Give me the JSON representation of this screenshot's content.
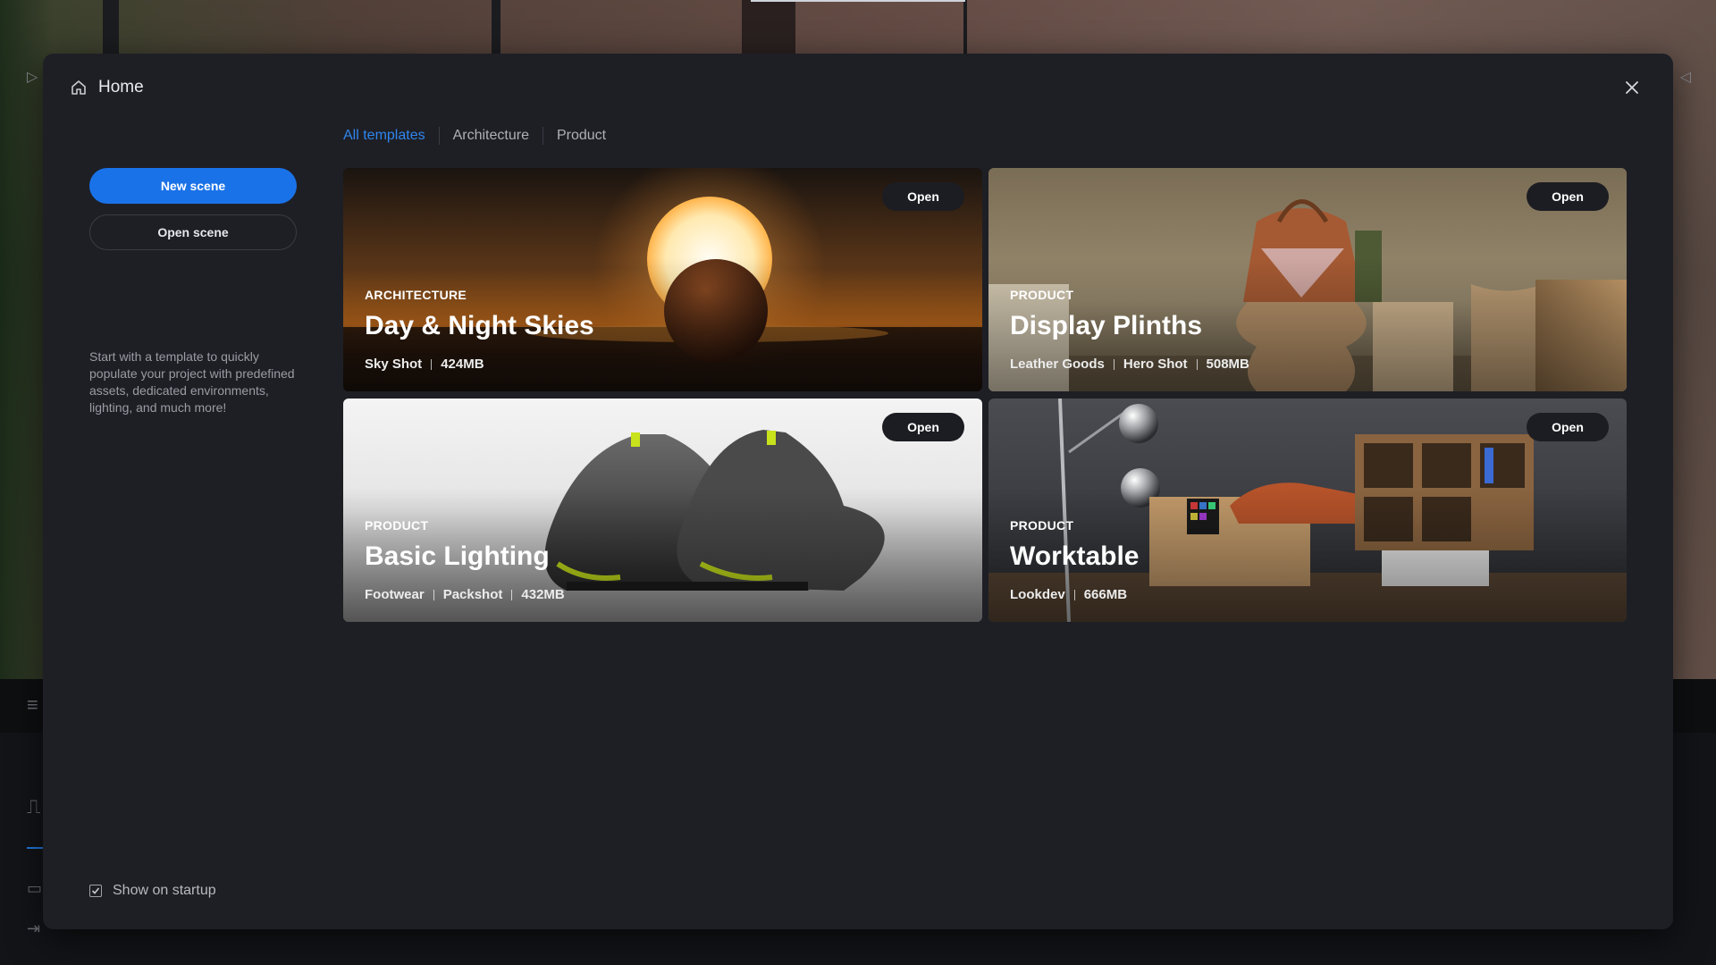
{
  "modal": {
    "title": "Home",
    "home_icon": "home-icon",
    "close_icon": "close-icon"
  },
  "sidebar": {
    "new_scene_label": "New scene",
    "open_scene_label": "Open scene",
    "intro_text": "Start with a template to quickly populate your project with predefined assets, dedicated environments, lighting, and much more!",
    "show_on_startup_label": "Show on startup",
    "show_on_startup_checked": true
  },
  "tabs": [
    {
      "label": "All templates",
      "active": true
    },
    {
      "label": "Architecture",
      "active": false
    },
    {
      "label": "Product",
      "active": false
    }
  ],
  "cards": [
    {
      "category": "ARCHITECTURE",
      "title": "Day & Night Skies",
      "meta": [
        "Sky Shot",
        "424MB"
      ],
      "open_label": "Open"
    },
    {
      "category": "PRODUCT",
      "title": "Display Plinths",
      "meta": [
        "Leather Goods",
        "Hero Shot",
        "508MB"
      ],
      "open_label": "Open"
    },
    {
      "category": "PRODUCT",
      "title": "Basic Lighting",
      "meta": [
        "Footwear",
        "Packshot",
        "432MB"
      ],
      "open_label": "Open"
    },
    {
      "category": "PRODUCT",
      "title": "Worktable",
      "meta": [
        "Lookdev",
        "666MB"
      ],
      "open_label": "Open"
    }
  ],
  "colors": {
    "accent": "#1a72e8",
    "tab_active": "#2f86ee",
    "modal_bg": "#1e1f25"
  }
}
